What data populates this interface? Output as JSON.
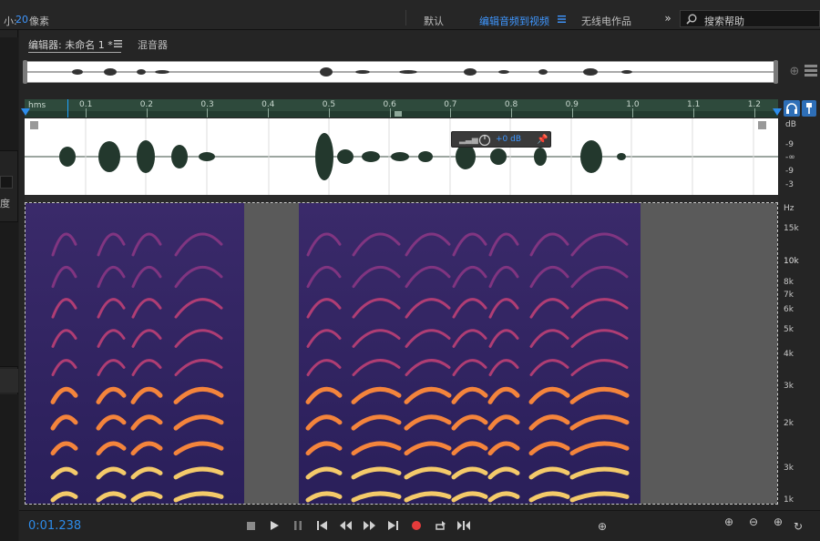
{
  "topbar": {
    "size_label": "小:",
    "size_value": "20",
    "size_unit": "像素",
    "workspaces": [
      "默认",
      "编辑音频到视频",
      "无线电作品"
    ],
    "active_workspace_index": 1,
    "overflow_icon": "double-chevron-right",
    "search_placeholder": "搜索帮助"
  },
  "left": {
    "label": "度"
  },
  "editor": {
    "tab_label": "编辑器: 未命名 1 *",
    "tab_menu_icon": "hamburger-menu",
    "mixer_label": "混音器",
    "ruler_unit": "hms",
    "ruler_ticks": [
      "0.1",
      "0.2",
      "0.3",
      "0.4",
      "0.5",
      "0.6",
      "0.7",
      "0.8",
      "0.9",
      "1.0",
      "1.1",
      "1.2"
    ],
    "hud_value": "+0 dB",
    "amp_labels": [
      "dB",
      "-9",
      "-∞",
      "-9",
      "-3"
    ],
    "freq_labels": [
      "Hz",
      "15k",
      "10k",
      "8k",
      "7k",
      "6k",
      "5k",
      "4k",
      "3k",
      "2k",
      "3k",
      "1k"
    ],
    "accent": "#2d8ceb"
  },
  "transport": {
    "time": "0:01.238",
    "buttons": [
      "stop",
      "play",
      "pause",
      "go-to-start",
      "rewind",
      "fast-forward",
      "go-to-end",
      "record",
      "loop",
      "skip-selection"
    ],
    "record_color": "#e53b3b"
  }
}
